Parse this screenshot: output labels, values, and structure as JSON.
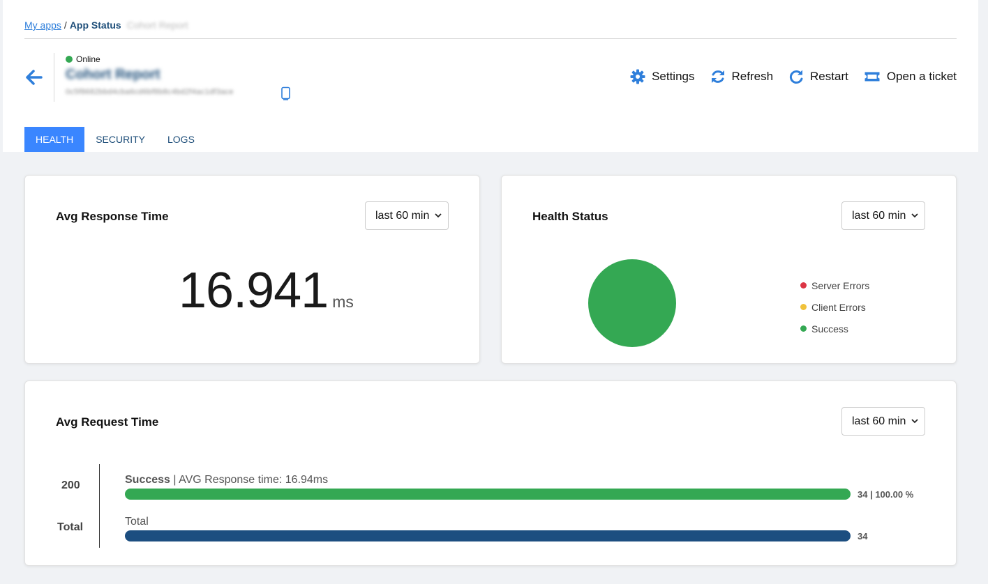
{
  "breadcrumb": {
    "root": "My apps",
    "separator": "/",
    "current": "App Status",
    "app": "Cohort Report"
  },
  "app": {
    "status": "Online",
    "name": "Cohort Report",
    "id": "0c5f8682bbd4cba6cd6bf8b8c4bd2f4ac1df3ace"
  },
  "actions": {
    "settings": "Settings",
    "refresh": "Refresh",
    "restart": "Restart",
    "ticket": "Open a ticket"
  },
  "tabs": [
    "HEALTH",
    "SECURITY",
    "LOGS"
  ],
  "response_card": {
    "title": "Avg Response Time",
    "range": "last 60 min",
    "value": "16.941",
    "unit": "ms"
  },
  "health_card": {
    "title": "Health Status",
    "range": "last 60 min",
    "legend": [
      {
        "label": "Server Errors",
        "color": "#dc3545"
      },
      {
        "label": "Client Errors",
        "color": "#f0c23b"
      },
      {
        "label": "Success",
        "color": "#34a853"
      }
    ]
  },
  "request_card": {
    "title": "Avg Request Time",
    "range": "last 60 min",
    "rows": [
      {
        "ylabel": "200",
        "name": "Success",
        "detail": "| AVG Response time: 16.94ms",
        "value": "34 | 100.00 %",
        "fraction": 1.0,
        "color": "#34a853"
      },
      {
        "ylabel": "Total",
        "name": "Total",
        "detail": "",
        "value": "34",
        "fraction": 1.0,
        "color": "#1c4e80"
      }
    ]
  },
  "chart_data": {
    "type": "pie",
    "labels": [
      "Server Errors",
      "Client Errors",
      "Success"
    ],
    "values": [
      0,
      0,
      34
    ],
    "colors": [
      "#dc3545",
      "#f0c23b",
      "#34a853"
    ]
  },
  "colors": {
    "accent": "#3a86ff",
    "link": "#2f7fdb",
    "online": "#34a853",
    "navy": "#1c4e80"
  }
}
